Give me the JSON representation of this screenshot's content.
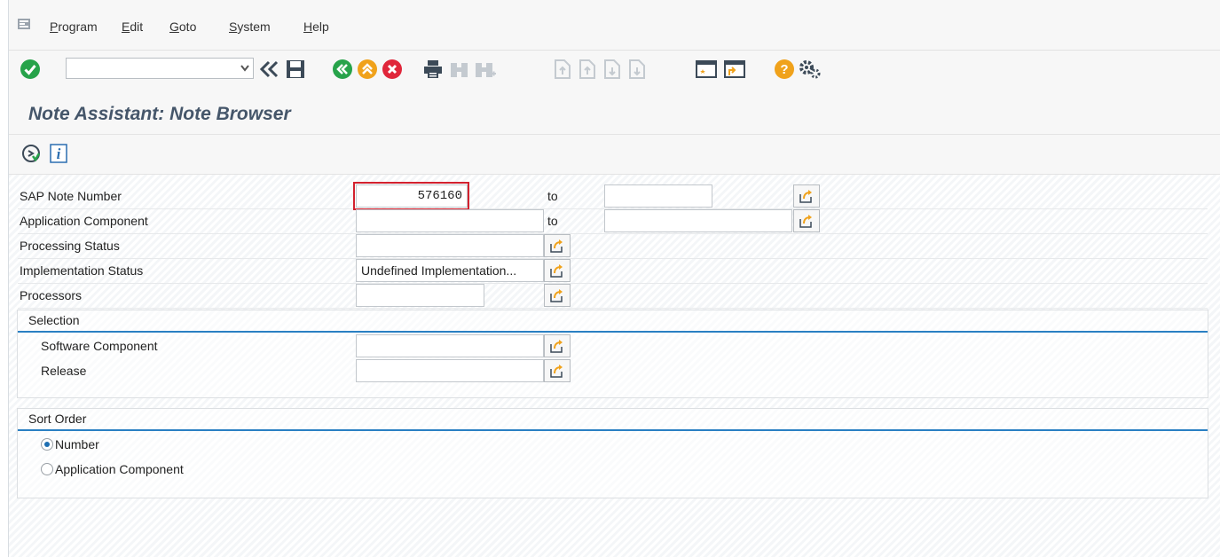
{
  "menu": {
    "items": [
      {
        "label": "Program"
      },
      {
        "label": "Edit"
      },
      {
        "label": "Goto"
      },
      {
        "label": "System"
      },
      {
        "label": "Help"
      }
    ]
  },
  "toolbar": {
    "command_field_value": "",
    "icons": [
      "enter-check-icon",
      "back-double-arrow-icon",
      "save-icon",
      "back-icon",
      "exit-icon",
      "cancel-icon",
      "print-icon",
      "find-icon",
      "find-next-icon",
      "first-page-icon",
      "previous-page-icon",
      "next-page-icon",
      "last-page-icon",
      "create-session-icon",
      "shortcut-icon",
      "help-icon",
      "customize-layout-icon"
    ]
  },
  "title": "Note Assistant: Note Browser",
  "app_toolbar": {
    "icons": [
      "execute-icon",
      "information-icon"
    ]
  },
  "form": {
    "note_number": {
      "label": "SAP Note Number",
      "from": "576160",
      "to_label": "to",
      "to": ""
    },
    "app_component": {
      "label": "Application Component",
      "from": "",
      "to_label": "to",
      "to": ""
    },
    "processing_status": {
      "label": "Processing Status",
      "value": ""
    },
    "implementation_status": {
      "label": "Implementation Status",
      "value": "Undefined Implementation..."
    },
    "processors": {
      "label": "Processors",
      "value": ""
    }
  },
  "selection": {
    "title": "Selection",
    "software_component": {
      "label": "Software Component",
      "value": ""
    },
    "release": {
      "label": "Release",
      "value": ""
    }
  },
  "sort_order": {
    "title": "Sort Order",
    "options": [
      {
        "label": "Number",
        "selected": true
      },
      {
        "label": "Application Component",
        "selected": false
      }
    ]
  },
  "colors": {
    "accent": "#2a80c3",
    "highlight": "#d3212e",
    "title": "#45566a",
    "green": "#27a34a",
    "orange": "#f0a21b",
    "red": "#e0263a"
  }
}
